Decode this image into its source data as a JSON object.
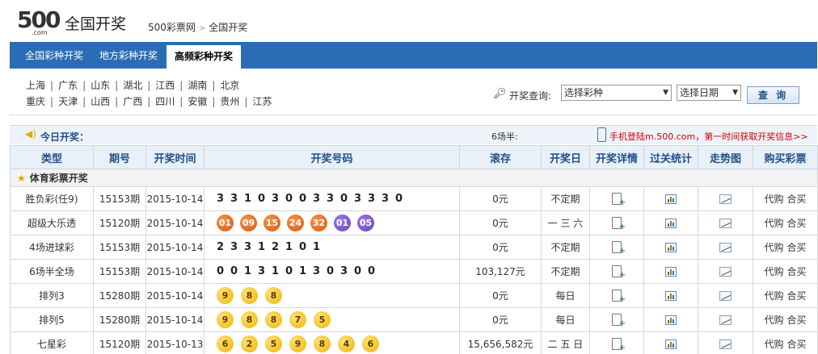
{
  "header": {
    "logo_number": "500",
    "logo_domain": ".com",
    "title": "全国开奖",
    "breadcrumb": [
      "500彩票网",
      "全国开奖"
    ],
    "breadcrumb_separator": ">"
  },
  "nav": {
    "tabs": [
      {
        "label": "全国彩种开奖",
        "active": false
      },
      {
        "label": "地方彩种开奖",
        "active": false
      },
      {
        "label": "高频彩种开奖",
        "active": true
      }
    ]
  },
  "regions": {
    "row1": [
      "上海",
      "广东",
      "山东",
      "湖北",
      "江西",
      "湖南",
      "北京"
    ],
    "row2": [
      "重庆",
      "天津",
      "山西",
      "广西",
      "四川",
      "安徽",
      "贵州",
      "江苏"
    ]
  },
  "query": {
    "label": "开奖查询:",
    "lottery_select": "选择彩种",
    "date_select": "选择日期",
    "button": "查 询"
  },
  "today": {
    "label": "今日开奖：",
    "count": "6场半:",
    "mobile_notice": "手机登陆m.500.com，第一时间获取开奖信息>>"
  },
  "table": {
    "headers": [
      "类型",
      "期号",
      "开奖时间",
      "开奖号码",
      "滚存",
      "开奖日",
      "开奖详情",
      "过关统计",
      "走势图",
      "购买彩票"
    ],
    "category": "体育彩票开奖",
    "buy_labels": [
      "代购",
      "合买"
    ],
    "rows": [
      {
        "type": "胜负彩(任9)",
        "issue": "15153期",
        "date": "2015-10-14",
        "digits": [
          "3",
          "3",
          "1",
          "0",
          "3",
          "0",
          "0",
          "3",
          "3",
          "0",
          "3",
          "3",
          "3",
          "0"
        ],
        "pool": "0元",
        "day": "不定期"
      },
      {
        "type": "超级大乐透",
        "issue": "15120期",
        "date": "2015-10-14",
        "red_balls": [
          "01",
          "09",
          "15",
          "24",
          "32"
        ],
        "blue_balls": [
          "01",
          "05"
        ],
        "pool": "0元",
        "day": "一 三 六"
      },
      {
        "type": "4场进球彩",
        "issue": "15153期",
        "date": "2015-10-14",
        "digits": [
          "2",
          "3",
          "3",
          "1",
          "2",
          "1",
          "0",
          "1"
        ],
        "pool": "0元",
        "day": "不定期"
      },
      {
        "type": "6场半全场",
        "issue": "15153期",
        "date": "2015-10-14",
        "digits": [
          "0",
          "0",
          "1",
          "3",
          "1",
          "0",
          "1",
          "3",
          "0",
          "3",
          "0",
          "0"
        ],
        "pool": "103,127元",
        "day": "不定期"
      },
      {
        "type": "排列3",
        "issue": "15280期",
        "date": "2015-10-14",
        "yellow_balls": [
          "9",
          "8",
          "8"
        ],
        "pool": "0元",
        "day": "每日"
      },
      {
        "type": "排列5",
        "issue": "15280期",
        "date": "2015-10-14",
        "yellow_balls": [
          "9",
          "8",
          "8",
          "7",
          "5"
        ],
        "pool": "0元",
        "day": "每日"
      },
      {
        "type": "七星彩",
        "issue": "15120期",
        "date": "2015-10-13",
        "yellow_balls": [
          "6",
          "2",
          "5",
          "9",
          "8",
          "4",
          "6"
        ],
        "pool": "15,656,582元",
        "day": "二 五 日"
      }
    ]
  },
  "colors": {
    "nav_blue": "#2a6db5",
    "red_ball": "#e0621a",
    "blue_ball": "#6a42c4",
    "yellow_ball": "#f2b300",
    "notice_red": "#d20000"
  }
}
